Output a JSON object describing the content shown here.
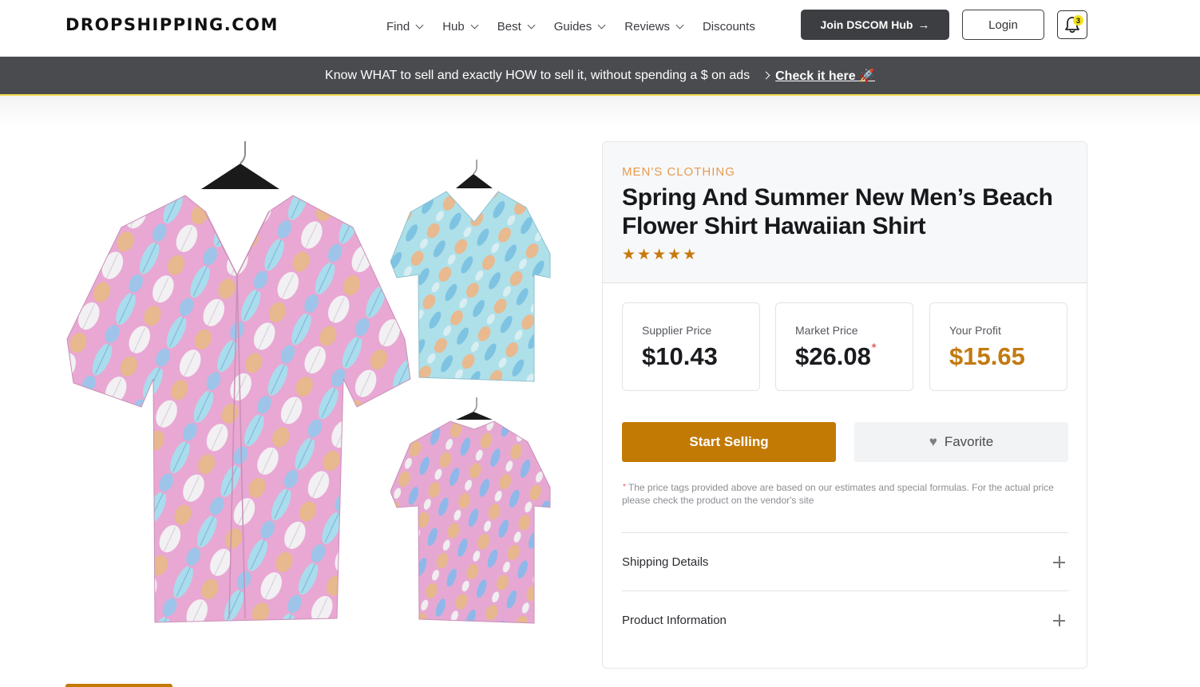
{
  "header": {
    "logo": "DROPSHIPPING.COM",
    "nav": [
      {
        "label": "Find",
        "dropdown": true
      },
      {
        "label": "Hub",
        "dropdown": true
      },
      {
        "label": "Best",
        "dropdown": true
      },
      {
        "label": "Guides",
        "dropdown": true
      },
      {
        "label": "Reviews",
        "dropdown": true
      },
      {
        "label": "Discounts",
        "dropdown": false
      }
    ],
    "join_label": "Join DSCOM Hub",
    "login_label": "Login",
    "notification_count": "3"
  },
  "announcement": {
    "text": "Know WHAT to sell and exactly HOW to sell it, without spending a $ on ads",
    "link": "Check it here 🚀"
  },
  "product": {
    "category": "MEN'S CLOTHING",
    "title": "Spring And Summer New Men’s Beach Flower Shirt Hawaiian Shirt",
    "rating": 5,
    "prices": {
      "supplier_label": "Supplier Price",
      "supplier_value": "$10.43",
      "market_label": "Market Price",
      "market_value": "$26.08",
      "market_asterisk": "*",
      "profit_label": "Your Profit",
      "profit_value": "$15.65"
    },
    "start_selling_label": "Start Selling",
    "favorite_label": "Favorite",
    "disclaimer_asterisk": "*",
    "disclaimer": "The price tags provided above are based on our estimates and special formulas. For the actual price please check the product on the vendor's site",
    "accordions": [
      {
        "label": "Shipping Details"
      },
      {
        "label": "Product Information"
      }
    ]
  },
  "colors": {
    "accent": "#c27a05",
    "category": "#e69a4f",
    "dark_button": "#3d3e42",
    "announcement_bg": "#4a4b4f",
    "shirt_pink": "#e7a6d1",
    "shirt_blue": "#a8dcea"
  },
  "icons": [
    "chevron-down-icon",
    "arrow-right-icon",
    "bell-icon",
    "chevron-right-icon",
    "rocket-icon",
    "star-icon",
    "heart-icon",
    "plus-icon"
  ]
}
